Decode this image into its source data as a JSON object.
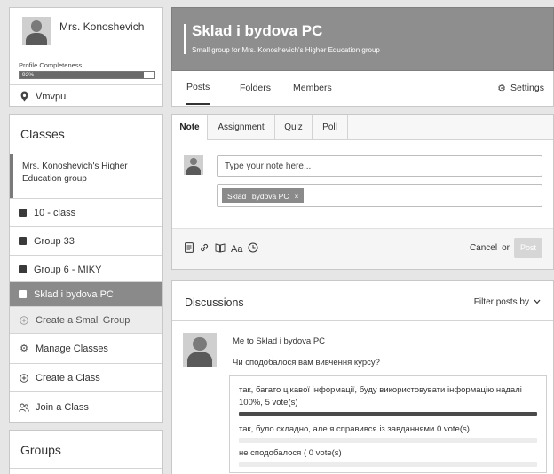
{
  "profile": {
    "name": "Mrs. Konoshevich",
    "completeness_label": "Profile Completeness",
    "completeness_value": "92%",
    "completeness_fraction": 0.92,
    "location": "Vmvpu"
  },
  "classes": {
    "heading": "Classes",
    "main_group": "Mrs. Konoshevich's Higher Education group",
    "items": [
      "10 - class",
      "Group 33",
      "Group 6 - MIKY",
      "Sklad i bydova PC"
    ],
    "create_small_group": "Create a Small Group",
    "manage": "Manage Classes",
    "create_class": "Create a Class",
    "join_class": "Join a Class"
  },
  "groups": {
    "heading": "Groups"
  },
  "header": {
    "title": "Sklad i bydova PC",
    "subtitle": "Small group for Mrs. Konoshevich's Higher Education group"
  },
  "nav": {
    "posts": "Posts",
    "folders": "Folders",
    "members": "Members",
    "settings": "Settings"
  },
  "composer": {
    "tabs": [
      "Note",
      "Assignment",
      "Quiz",
      "Poll"
    ],
    "placeholder": "Type your note here...",
    "recipient_chip": "Sklad i bydova PC",
    "chip_remove": "×",
    "format_label": "Aa",
    "cancel": "Cancel",
    "or": "or",
    "post": "Post"
  },
  "discussions": {
    "heading": "Discussions",
    "filter": "Filter posts by"
  },
  "post": {
    "meta": "Me to Sklad i bydova PC",
    "question": "Чи сподобалося вам вивчення курсу?",
    "options": [
      {
        "text": "так, багато цікавої інформації, буду використовувати інформацію надалі",
        "result": "100%, 5 vote(s)",
        "fraction": 1.0
      },
      {
        "text": "так, було складно, але я справився із завданнями",
        "result": "0 vote(s)",
        "fraction": 0
      },
      {
        "text": "не сподобалося (",
        "result": "0 vote(s)",
        "fraction": 0
      }
    ]
  },
  "colors": {
    "header_bg": "#8e8e8e",
    "selected_item_bg": "#8a8a8a",
    "poll_fill": "#4a4a4a"
  }
}
